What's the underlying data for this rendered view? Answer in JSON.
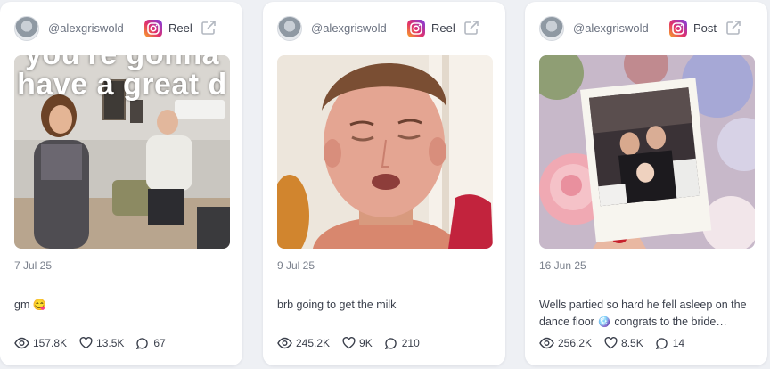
{
  "cards": [
    {
      "handle": "@alexgriswold",
      "post_type": "Reel",
      "overlay_text": "you're gonna have a great d",
      "date": "7 Jul 25",
      "caption": "gm 😋",
      "views": "157.8K",
      "likes": "13.5K",
      "comments": "67"
    },
    {
      "handle": "@alexgriswold",
      "post_type": "Reel",
      "date": "9 Jul 25",
      "caption": "brb going to get the milk",
      "views": "245.2K",
      "likes": "9K",
      "comments": "210"
    },
    {
      "handle": "@alexgriswold",
      "post_type": "Post",
      "date": "16 Jun 25",
      "caption": "Wells partied so hard he fell asleep on the dance floor 🪩 congrats to the bride…",
      "views": "256.2K",
      "likes": "8.5K",
      "comments": "14"
    }
  ],
  "icons": {
    "platform": "instagram-icon",
    "external": "external-link-icon",
    "views": "eye-icon",
    "likes": "heart-icon",
    "comments": "comment-icon"
  }
}
